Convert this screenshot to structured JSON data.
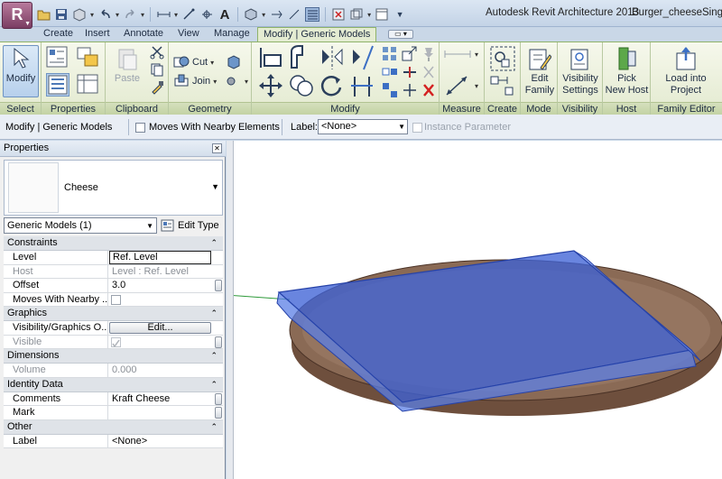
{
  "window": {
    "app_title": "Autodesk Revit Architecture 2013",
    "doc_title": "Burger_cheeseSing",
    "app_button": "R"
  },
  "tabs": [
    {
      "label": "Create"
    },
    {
      "label": "Insert"
    },
    {
      "label": "Annotate"
    },
    {
      "label": "View"
    },
    {
      "label": "Manage"
    },
    {
      "label": "Modify | Generic Models",
      "active": true
    }
  ],
  "ribbon": {
    "panels": {
      "select": "Select",
      "properties": "Properties",
      "clipboard": "Clipboard",
      "geometry": "Geometry",
      "modify": "Modify",
      "measure": "Measure",
      "create": "Create",
      "mode": "Mode",
      "visibility": "Visibility",
      "host": "Host",
      "family_editor": "Family Editor"
    },
    "buttons": {
      "modify": "Modify",
      "paste": "Paste",
      "cut": "Cut",
      "join": "Join",
      "edit_family_1": "Edit",
      "edit_family_2": "Family",
      "visibility_settings_1": "Visibility",
      "visibility_settings_2": "Settings",
      "pick_new_host_1": "Pick",
      "pick_new_host_2": "New Host",
      "load_into_project_1": "Load into",
      "load_into_project_2": "Project"
    }
  },
  "options_bar": {
    "context": "Modify | Generic Models",
    "moves_with_nearby": "Moves With Nearby Elements",
    "label_caption": "Label:",
    "label_value": "<None>",
    "instance_parameter": "Instance Parameter"
  },
  "properties": {
    "title": "Properties",
    "type_name": "Cheese",
    "category": "Generic Models (1)",
    "edit_type": "Edit Type",
    "groups": {
      "constraints": "Constraints",
      "graphics": "Graphics",
      "dimensions": "Dimensions",
      "identity": "Identity Data",
      "other": "Other"
    },
    "rows": {
      "level_k": "Level",
      "level_v": "Ref. Level",
      "host_k": "Host",
      "host_v": "Level : Ref. Level",
      "offset_k": "Offset",
      "offset_v": "3.0",
      "moves_k": "Moves With Nearby ...",
      "visgraph_k": "Visibility/Graphics O...",
      "visgraph_v": "Edit...",
      "visible_k": "Visible",
      "volume_k": "Volume",
      "volume_v": "0.000",
      "comments_k": "Comments",
      "comments_v": "Kraft Cheese",
      "mark_k": "Mark",
      "mark_v": "",
      "label_k": "Label",
      "label_v": "<None>"
    }
  },
  "colors": {
    "ribbon_accent": "#8fb36a",
    "cheese_fill": "#3f63d6",
    "bun_fill": "#7a5a47"
  }
}
